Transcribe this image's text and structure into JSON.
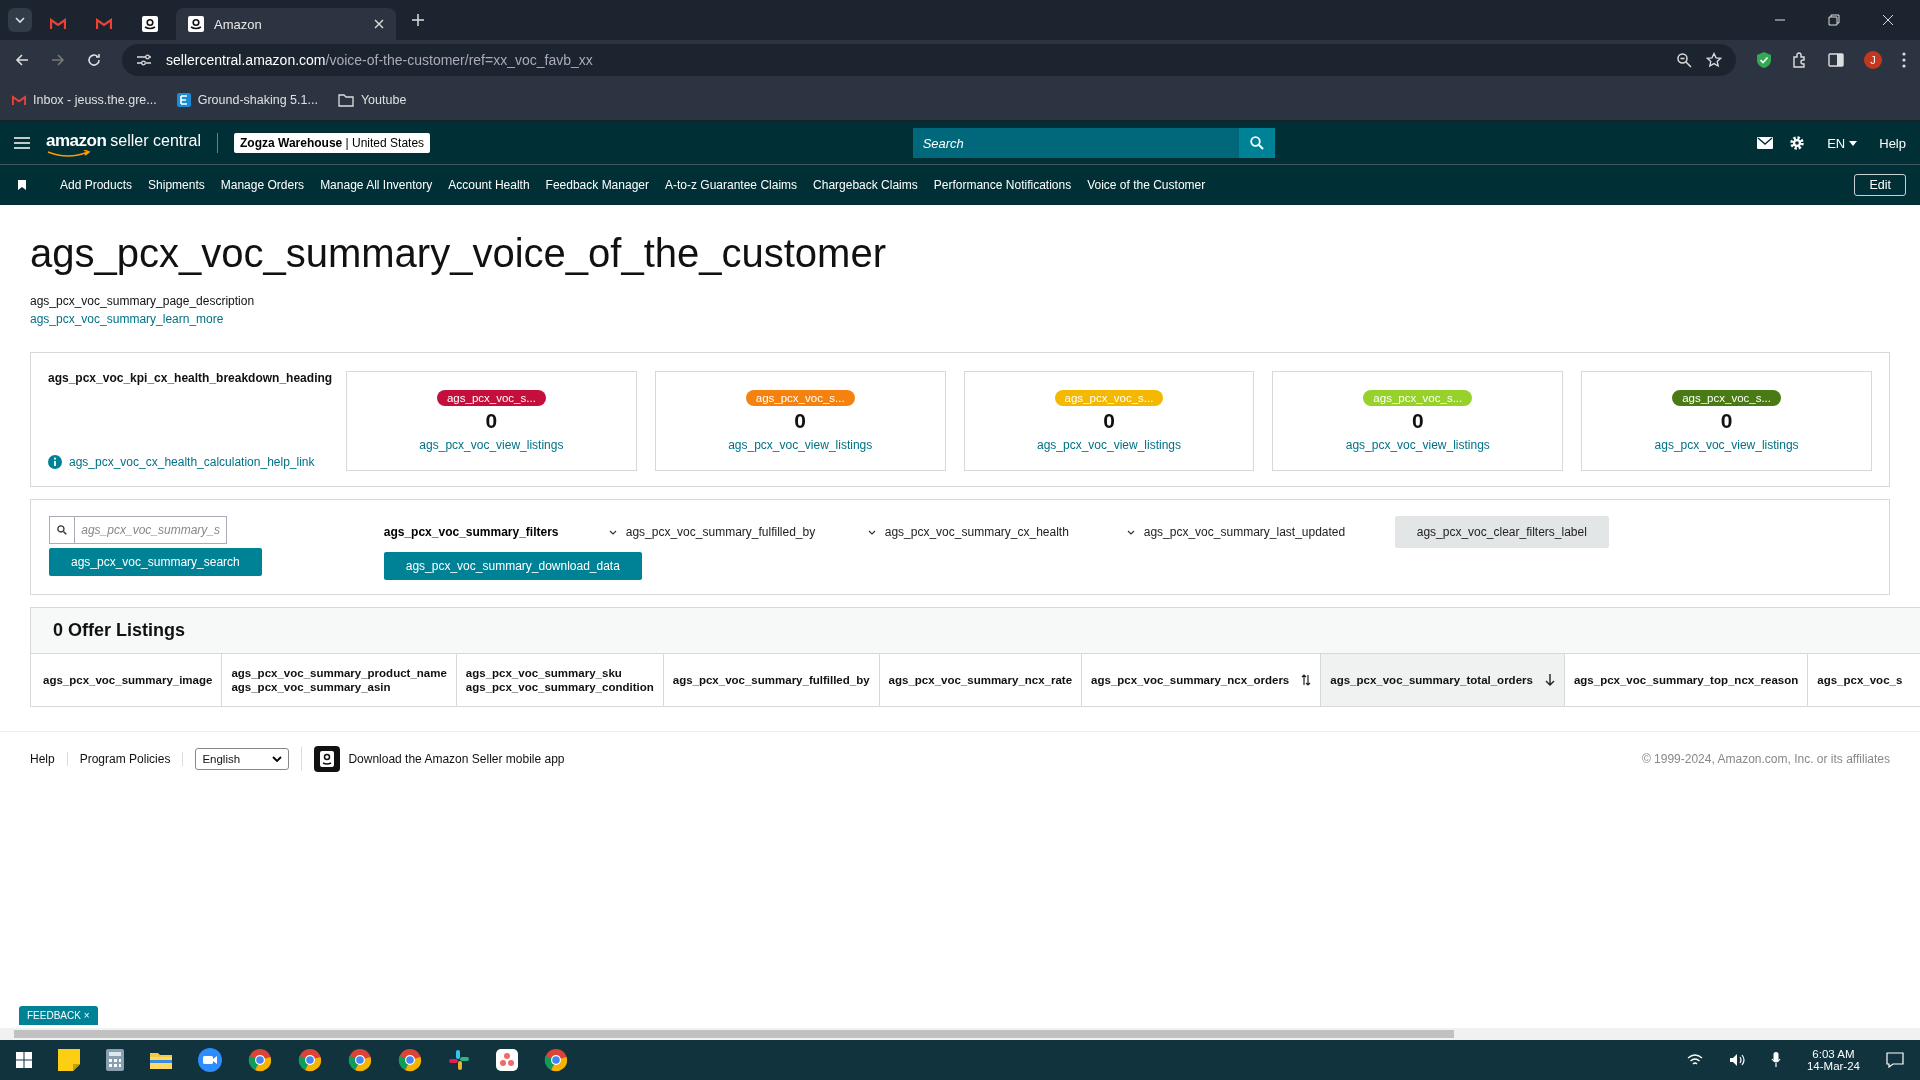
{
  "browser": {
    "tabs": [
      {
        "kind": "mail",
        "selected": false
      },
      {
        "kind": "mail",
        "selected": false
      },
      {
        "kind": "store",
        "selected": false
      },
      {
        "kind": "store",
        "title": "Amazon",
        "selected": true
      }
    ],
    "url_host": "sellercentral.amazon.com",
    "url_path": "/voice-of-the-customer/ref=xx_voc_favb_xx",
    "bookmarks": [
      {
        "kind": "mail",
        "label": "Inbox - jeuss.the.gre..."
      },
      {
        "kind": "letter-e",
        "label": "Ground-shaking 5.1..."
      },
      {
        "kind": "folder",
        "label": "Youtube"
      }
    ],
    "profile_initial": "J"
  },
  "header": {
    "logo": "amazon",
    "logo_suffix": "seller central",
    "store_name": "Zogza Warehouse",
    "marketplace": "| United States",
    "search_placeholder": "Search",
    "language": "EN",
    "help": "Help"
  },
  "nav": {
    "items": [
      "Add Products",
      "Shipments",
      "Manage Orders",
      "Manage All Inventory",
      "Account Health",
      "Feedback Manager",
      "A-to-z Guarantee Claims",
      "Chargeback Claims",
      "Performance Notifications",
      "Voice of the Customer"
    ],
    "edit": "Edit"
  },
  "page": {
    "title": "ags_pcx_voc_summary_voice_of_the_customer",
    "description": "ags_pcx_voc_summary_page_description",
    "learn_more": "ags_pcx_voc_summary_learn_more"
  },
  "kpi": {
    "heading": "ags_pcx_voc_kpi_cx_health_breakdown_heading",
    "help_link": "ags_pcx_voc_cx_health_calculation_help_link",
    "cards": [
      {
        "badge": "ags_pcx_voc_s...",
        "color": "#c40f3c",
        "count": "0",
        "link": "ags_pcx_voc_view_listings"
      },
      {
        "badge": "ags_pcx_voc_s...",
        "color": "#f5820f",
        "count": "0",
        "link": "ags_pcx_voc_view_listings"
      },
      {
        "badge": "ags_pcx_voc_s...",
        "color": "#f5b800",
        "count": "0",
        "link": "ags_pcx_voc_view_listings"
      },
      {
        "badge": "ags_pcx_voc_s...",
        "color": "#96d22b",
        "count": "0",
        "link": "ags_pcx_voc_view_listings"
      },
      {
        "badge": "ags_pcx_voc_s...",
        "color": "#4a7a14",
        "count": "0",
        "link": "ags_pcx_voc_view_listings"
      }
    ]
  },
  "filters": {
    "search_placeholder": "ags_pcx_voc_summary_s",
    "search_button": "ags_pcx_voc_summary_search",
    "label": "ags_pcx_voc_summary_filters",
    "dropdowns": [
      "ags_pcx_voc_summary_fulfilled_by",
      "ags_pcx_voc_summary_cx_health",
      "ags_pcx_voc_summary_last_updated"
    ],
    "clear": "ags_pcx_voc_clear_filters_label",
    "download": "ags_pcx_voc_summary_download_data"
  },
  "listings": {
    "title": "0 Offer Listings",
    "columns": [
      {
        "lines": [
          "ags_pcx_voc_summary_image"
        ],
        "sortable": false,
        "sorted": false
      },
      {
        "lines": [
          "ags_pcx_voc_summary_product_name",
          "ags_pcx_voc_summary_asin"
        ],
        "sortable": false,
        "sorted": false
      },
      {
        "lines": [
          "ags_pcx_voc_summary_sku",
          "ags_pcx_voc_summary_condition"
        ],
        "sortable": false,
        "sorted": false
      },
      {
        "lines": [
          "ags_pcx_voc_summary_fulfilled_by"
        ],
        "sortable": false,
        "sorted": false
      },
      {
        "lines": [
          "ags_pcx_voc_summary_ncx_rate"
        ],
        "sortable": false,
        "sorted": false
      },
      {
        "lines": [
          "ags_pcx_voc_summary_ncx_orders"
        ],
        "sortable": true,
        "sorted": false
      },
      {
        "lines": [
          "ags_pcx_voc_summary_total_orders"
        ],
        "sortable": true,
        "sorted": true
      },
      {
        "lines": [
          "ags_pcx_voc_summary_top_ncx_reason"
        ],
        "sortable": false,
        "sorted": false
      },
      {
        "lines": [
          "ags_pcx_voc_s"
        ],
        "sortable": false,
        "sorted": false
      }
    ]
  },
  "footer": {
    "links": [
      "Help",
      "Program Policies"
    ],
    "language": "English",
    "app_link": "Download the Amazon Seller mobile app",
    "copyright": "© 1999-2024, Amazon.com, Inc. or its affiliates"
  },
  "feedback": "FEEDBACK",
  "feedback_close": "×",
  "taskbar": {
    "time": "6:03 AM",
    "date": "14-Mar-24"
  }
}
